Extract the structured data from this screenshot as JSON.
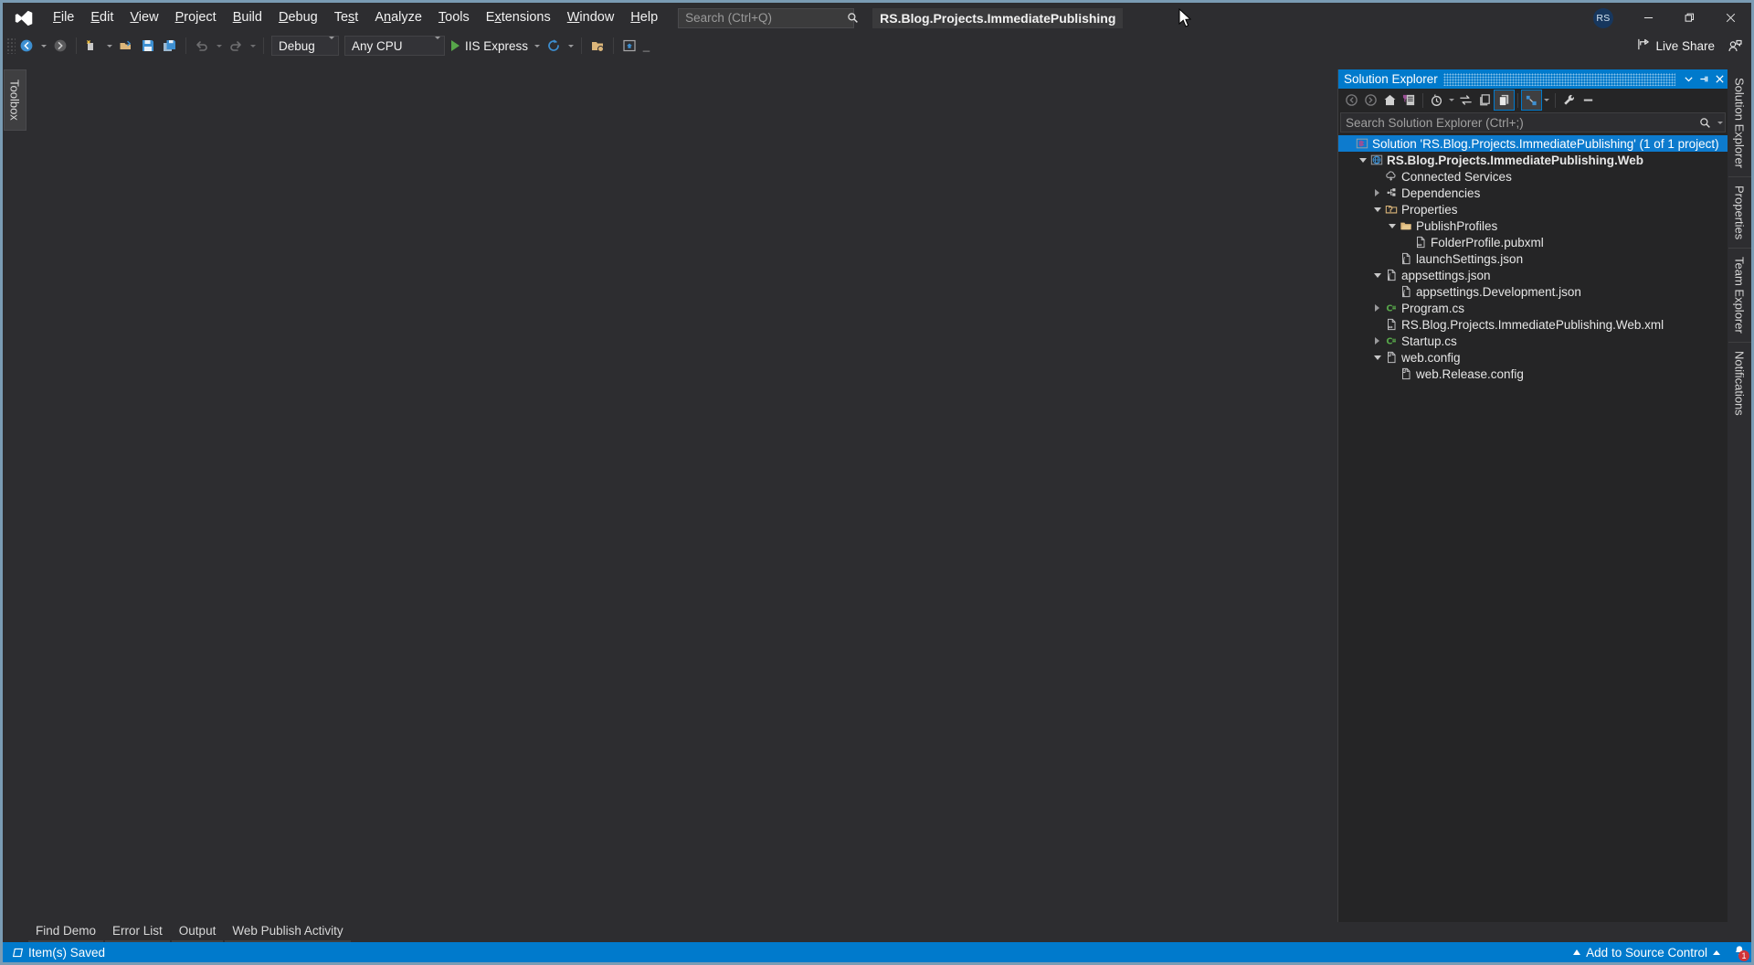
{
  "titlebar": {
    "logo_icon": "visual-studio-logo",
    "menus": [
      {
        "label": "File",
        "accel": "F"
      },
      {
        "label": "Edit",
        "accel": "E"
      },
      {
        "label": "View",
        "accel": "V"
      },
      {
        "label": "Project",
        "accel": "P"
      },
      {
        "label": "Build",
        "accel": "B"
      },
      {
        "label": "Debug",
        "accel": "D"
      },
      {
        "label": "Test",
        "accel": "s"
      },
      {
        "label": "Analyze",
        "accel": "n"
      },
      {
        "label": "Tools",
        "accel": "T"
      },
      {
        "label": "Extensions",
        "accel": "x"
      },
      {
        "label": "Window",
        "accel": "W"
      },
      {
        "label": "Help",
        "accel": "H"
      }
    ],
    "search_placeholder": "Search (Ctrl+Q)",
    "search_value": "",
    "search_icon": "search-icon",
    "project_title": "RS.Blog.Projects.ImmediatePublishing",
    "user_initials": "RS",
    "minimize_label": "Minimize",
    "restore_label": "Restore Down",
    "close_label": "Close"
  },
  "toolbar": {
    "navigate_back": "Navigate Backward",
    "navigate_forward": "Navigate Forward",
    "new_project": "New Project",
    "open_file": "Open File",
    "save": "Save",
    "save_all": "Save All",
    "undo": "Undo",
    "redo": "Redo",
    "config_value": "Debug",
    "platform_value": "Any CPU",
    "run_label": "IIS Express",
    "hot_reload": "Hot Reload",
    "live_share_label": "Live Share",
    "live_share_icon": "live-share-icon",
    "feedback_icon": "send-feedback-icon"
  },
  "left_strip": {
    "tabs": [
      {
        "label": "Toolbox",
        "name": "toolbox"
      }
    ]
  },
  "right_strip": {
    "tabs": [
      {
        "label": "Solution Explorer",
        "name": "solution-explorer"
      },
      {
        "label": "Properties",
        "name": "properties"
      },
      {
        "label": "Team Explorer",
        "name": "team-explorer"
      },
      {
        "label": "Notifications",
        "name": "notifications"
      }
    ]
  },
  "solution_explorer": {
    "title": "Solution Explorer",
    "header_menu_icon": "chevron-down-icon",
    "header_pin_icon": "pin-icon",
    "header_close_icon": "close-icon",
    "toolbar_buttons": [
      {
        "name": "back",
        "icon": "arrow-left-circle-icon",
        "active": false
      },
      {
        "name": "forward",
        "icon": "arrow-right-circle-icon",
        "active": false
      },
      {
        "name": "home",
        "icon": "home-icon",
        "active": false
      },
      {
        "name": "pending-changes",
        "icon": "pending-changes-filter-icon",
        "active": false
      },
      {
        "name": "history",
        "icon": "clock-icon",
        "active": false
      },
      {
        "name": "sync-with-active-document",
        "icon": "sync-icon",
        "active": false
      },
      {
        "name": "properties-window",
        "icon": "properties-icon",
        "active": false
      },
      {
        "name": "show-all-files",
        "icon": "show-all-files-icon",
        "active": true
      },
      {
        "name": "collapse-all",
        "icon": "collapse-all-icon",
        "active": true
      },
      {
        "name": "settings",
        "icon": "wrench-icon",
        "active": false
      },
      {
        "name": "preview-selected-items",
        "icon": "preview-icon",
        "active": false
      }
    ],
    "search_placeholder": "Search Solution Explorer (Ctrl+;)",
    "search_value": "",
    "search_icon": "search-icon",
    "tree": [
      {
        "label": "Solution 'RS.Blog.Projects.ImmediatePublishing' (1 of 1 project)",
        "depth": 0,
        "icon": "solution-icon",
        "twist": "none",
        "selected": true,
        "bold": false
      },
      {
        "label": "RS.Blog.Projects.ImmediatePublishing.Web",
        "depth": 1,
        "icon": "web-project-icon",
        "twist": "open",
        "selected": false,
        "bold": true
      },
      {
        "label": "Connected Services",
        "depth": 2,
        "icon": "connected-services-icon",
        "twist": "none",
        "selected": false,
        "bold": false
      },
      {
        "label": "Dependencies",
        "depth": 2,
        "icon": "dependencies-icon",
        "twist": "closed",
        "selected": false,
        "bold": false
      },
      {
        "label": "Properties",
        "depth": 2,
        "icon": "properties-folder-icon",
        "twist": "open",
        "selected": false,
        "bold": false
      },
      {
        "label": "PublishProfiles",
        "depth": 3,
        "icon": "folder-icon",
        "twist": "open",
        "selected": false,
        "bold": false
      },
      {
        "label": "FolderProfile.pubxml",
        "depth": 4,
        "icon": "xml-file-icon",
        "twist": "none",
        "selected": false,
        "bold": false
      },
      {
        "label": "launchSettings.json",
        "depth": 3,
        "icon": "json-file-icon",
        "twist": "none",
        "selected": false,
        "bold": false
      },
      {
        "label": "appsettings.json",
        "depth": 2,
        "icon": "json-file-icon",
        "twist": "open",
        "selected": false,
        "bold": false
      },
      {
        "label": "appsettings.Development.json",
        "depth": 3,
        "icon": "json-file-icon",
        "twist": "none",
        "selected": false,
        "bold": false
      },
      {
        "label": "Program.cs",
        "depth": 2,
        "icon": "csharp-file-icon",
        "twist": "closed",
        "selected": false,
        "bold": false
      },
      {
        "label": "RS.Blog.Projects.ImmediatePublishing.Web.xml",
        "depth": 2,
        "icon": "xml-file-icon",
        "twist": "none",
        "selected": false,
        "bold": false
      },
      {
        "label": "Startup.cs",
        "depth": 2,
        "icon": "csharp-file-icon",
        "twist": "closed",
        "selected": false,
        "bold": false
      },
      {
        "label": "web.config",
        "depth": 2,
        "icon": "config-file-icon",
        "twist": "open",
        "selected": false,
        "bold": false
      },
      {
        "label": "web.Release.config",
        "depth": 3,
        "icon": "config-file-icon",
        "twist": "none",
        "selected": false,
        "bold": false
      }
    ]
  },
  "bottom_tabs": [
    {
      "label": "Find Demo",
      "name": "find-demo"
    },
    {
      "label": "Error List",
      "name": "error-list"
    },
    {
      "label": "Output",
      "name": "output"
    },
    {
      "label": "Web Publish Activity",
      "name": "web-publish-activity"
    }
  ],
  "statusbar": {
    "status_icon": "saved-icon",
    "status_text": "Item(s) Saved",
    "source_control_label": "Add to Source Control",
    "notification_count": "1",
    "notification_icon": "bell-icon"
  },
  "colors": {
    "accent": "#007acc",
    "window_border": "#7a9cb4",
    "chrome_bg": "#2d2d30",
    "panel_bg": "#252526",
    "tree_selection": "#0d7bce",
    "run_green": "#57a64a",
    "badge_red": "#d13438"
  }
}
